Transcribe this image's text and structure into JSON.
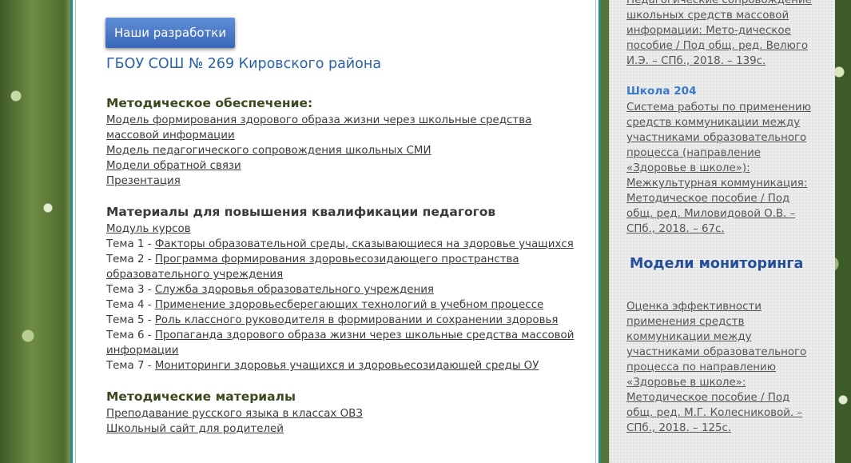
{
  "main": {
    "button_label": "Наши разработки",
    "school_name": "ГБОУ СОШ № 269 Кировского района",
    "sections": [
      {
        "heading": "Методическое обеспечение:",
        "lines": [
          "Модель формирования здорового образа жизни через школьные средства",
          "массовой информации",
          "Модель педагогического сопровождения школьных СМИ",
          "Модели обратной связи",
          "Презентация "
        ]
      },
      {
        "heading": "Материалы для повышения квалификации педагогов",
        "module": "Модуль курсов",
        "topics": [
          {
            "prefix": "Тема 1 - ",
            "link": "Факторы образовательной среды, сказывающиеся на здоровье учащихся",
            "cont": ""
          },
          {
            "prefix": "Тема 2 - ",
            "link": "Программа формирования здоровьесозидающего пространства",
            "cont": "образовательного учреждения"
          },
          {
            "prefix": "Тема 3 - ",
            "link": "Служба здоровья  образовательного учреждения",
            "cont": ""
          },
          {
            "prefix": "Тема 4 - ",
            "link": "Применение здоровьесберегающих технологий в учебном процессе",
            "cont": ""
          },
          {
            "prefix": "Тема 5 - ",
            "link": "Роль классного руководителя в формировании и сохранении здоровья",
            "cont": ""
          },
          {
            "prefix": "Тема 6 - ",
            "link": "Пропаганда здорового образа жизни через школьные средства массовой",
            "cont": "информации"
          },
          {
            "prefix": "Тема 7 - ",
            "link": "Мониторинги здоровья учащихся и здоровьесозидающей среды ОУ",
            "cont": ""
          }
        ]
      },
      {
        "heading": "Методические материалы",
        "lines": [
          "Преподавание русского языка в классах ОВЗ",
          "Школьный сайт для родителей"
        ]
      }
    ]
  },
  "sidebar": {
    "top_lines": [
      "Педагогические сопровождение",
      "школьных средств массовой",
      "информации: Мето-дическое",
      "пособие / Под общ. ред. Велюго",
      "И.Э. – СПб., 2018. – 139с."
    ],
    "school204": {
      "heading": "Школа 204",
      "lines": [
        "Система работы по применению",
        "средств коммуникации между",
        "участниками образовательного",
        "процесса (направление",
        "«Здоровье в школе»):",
        "Межкультурная коммуникация:",
        "Методическое пособие / Под",
        "общ. ред. Миловидовой О.В. –",
        "СПб., 2018. – 67с."
      ]
    },
    "monitoring": {
      "title": "Модели мониторинга",
      "lines": [
        "Оценка эффективности",
        "применения средств",
        "коммуникации между",
        "участниками образовательного",
        "процесса по направлению",
        "«Здоровье в школе»:",
        "Методическое пособие / Под",
        "общ. ред. М.Г. Колесниковой. –",
        "СПб., 2018. – 125с."
      ]
    }
  }
}
